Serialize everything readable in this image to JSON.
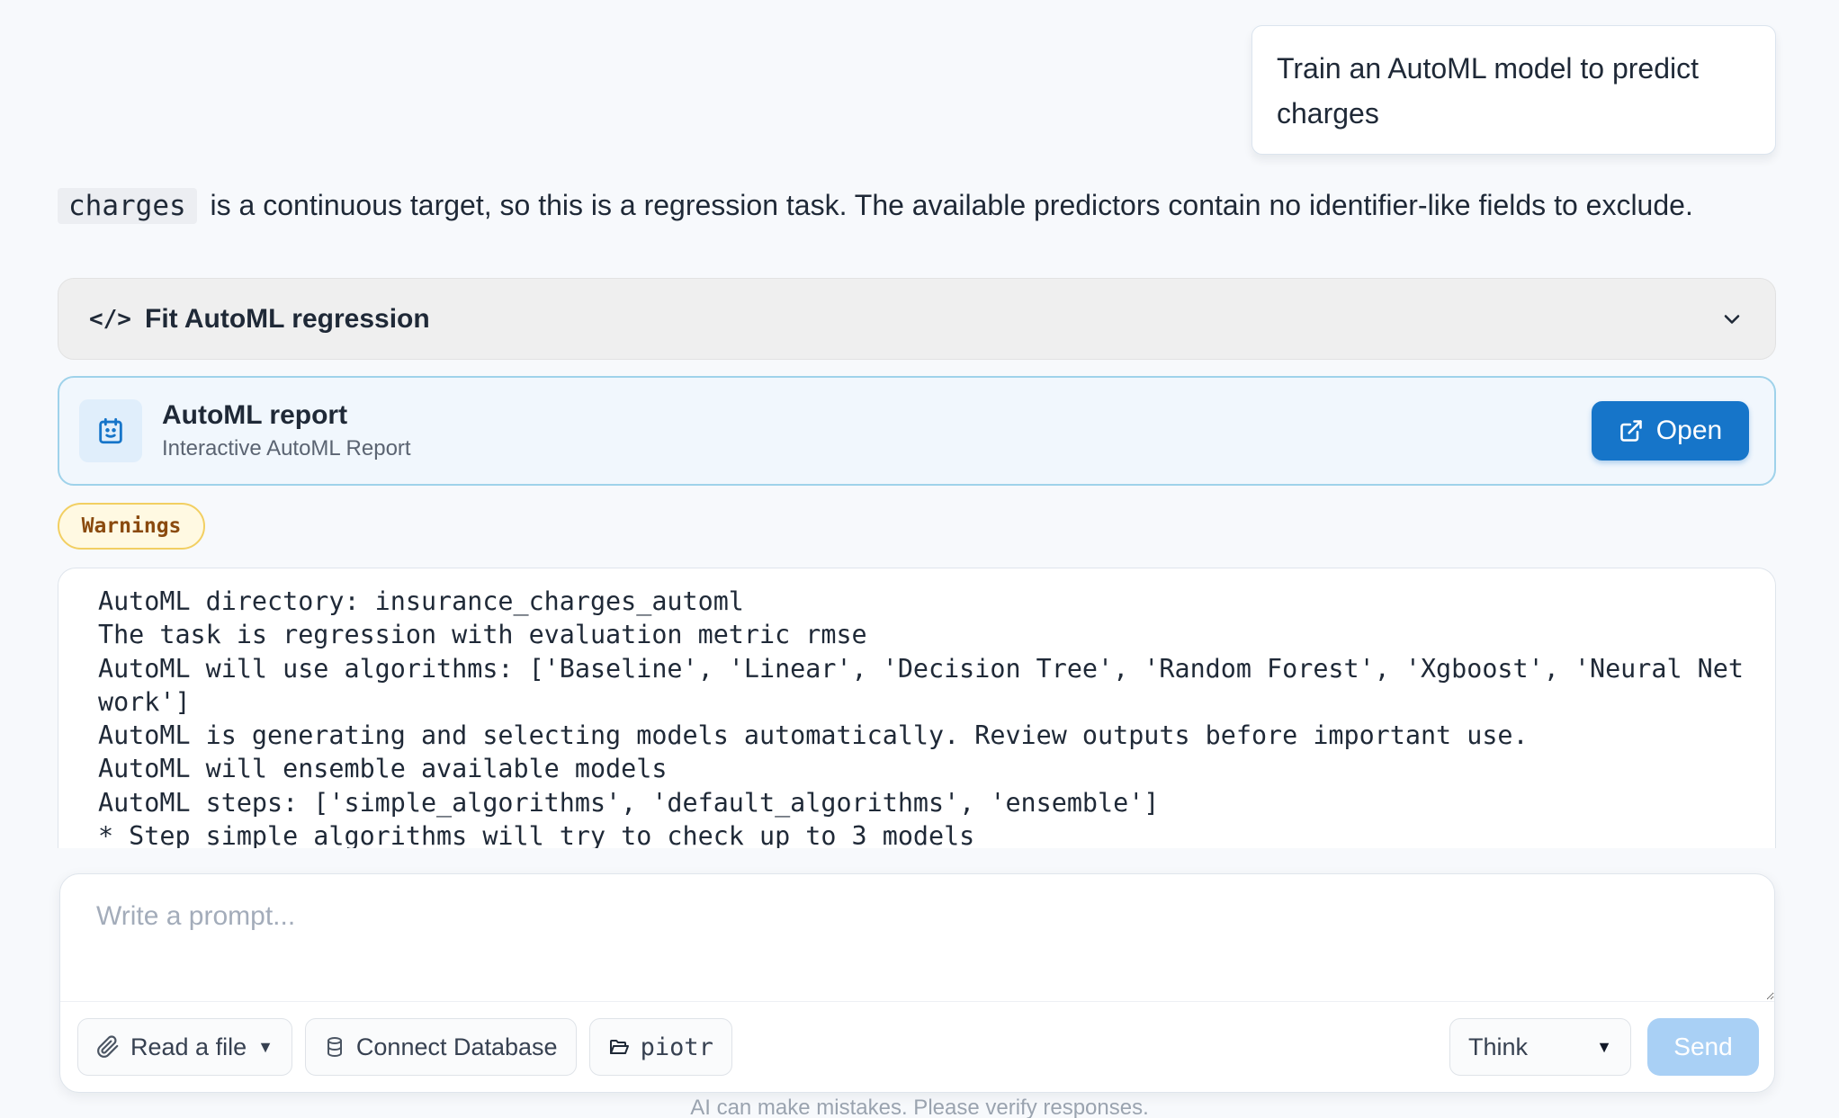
{
  "conversation": {
    "user_message": "Train an AutoML model to predict charges",
    "assistant_intro": {
      "code": "charges",
      "text": "is a continuous target, so this is a regression task. The available predictors contain no identifier-like fields to exclude."
    },
    "tool_call": {
      "icon": "code-icon",
      "title": "Fit AutoML regression"
    },
    "report_card": {
      "title": "AutoML report",
      "subtitle": "Interactive AutoML Report",
      "open_label": "Open",
      "accent_color": "#1675c9"
    },
    "warnings_label": "Warnings",
    "log_lines": [
      "AutoML directory: insurance_charges_automl",
      "The task is regression with evaluation metric rmse",
      "AutoML will use algorithms: ['Baseline', 'Linear', 'Decision Tree', 'Random Forest', 'Xgboost', 'Neural Net",
      "work']",
      "AutoML is generating and selecting models automatically. Review outputs before important use.",
      "AutoML will ensemble available models",
      "AutoML steps: ['simple_algorithms', 'default_algorithms', 'ensemble']",
      "* Step simple_algorithms will try to check up to 3 models"
    ]
  },
  "composer": {
    "placeholder": "Write a prompt...",
    "read_file_label": "Read a file",
    "connect_db_label": "Connect Database",
    "folder_label": "piotr",
    "mode_value": "Think",
    "send_label": "Send"
  },
  "disclaimer": "AI can make mistakes. Please verify responses."
}
